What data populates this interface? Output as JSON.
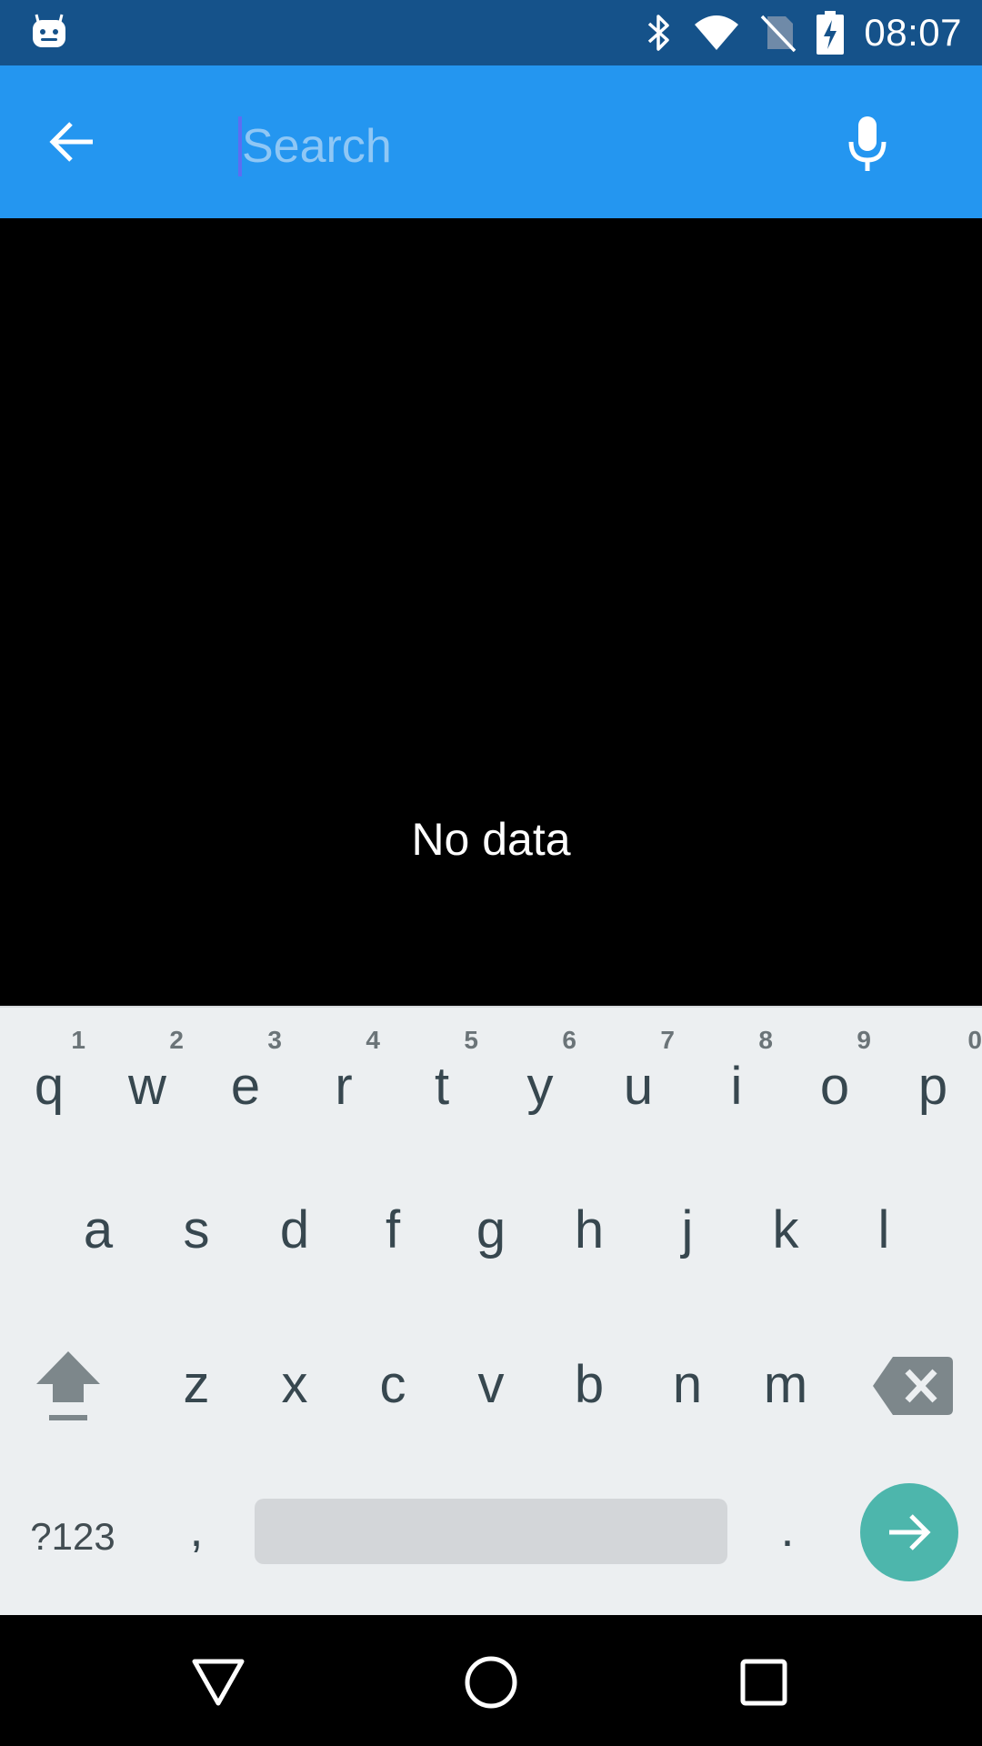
{
  "status_bar": {
    "time": "08:07",
    "icons": [
      "android-notification-icon",
      "bluetooth-icon",
      "wifi-icon",
      "no-sim-icon",
      "battery-charging-icon"
    ]
  },
  "app_bar": {
    "back_icon": "arrow-back-icon",
    "search_placeholder": "Search",
    "search_value": "",
    "mic_icon": "mic-icon"
  },
  "content": {
    "empty_message": "No data"
  },
  "keyboard": {
    "row1": [
      {
        "key": "q",
        "hint": "1"
      },
      {
        "key": "w",
        "hint": "2"
      },
      {
        "key": "e",
        "hint": "3"
      },
      {
        "key": "r",
        "hint": "4"
      },
      {
        "key": "t",
        "hint": "5"
      },
      {
        "key": "y",
        "hint": "6"
      },
      {
        "key": "u",
        "hint": "7"
      },
      {
        "key": "i",
        "hint": "8"
      },
      {
        "key": "o",
        "hint": "9"
      },
      {
        "key": "p",
        "hint": "0"
      }
    ],
    "row2": [
      "a",
      "s",
      "d",
      "f",
      "g",
      "h",
      "j",
      "k",
      "l"
    ],
    "row3": [
      "z",
      "x",
      "c",
      "v",
      "b",
      "n",
      "m"
    ],
    "symbols_label": "?123",
    "comma_label": ",",
    "period_label": ".",
    "enter_icon": "arrow-forward-icon",
    "shift_icon": "shift-icon",
    "delete_icon": "backspace-icon"
  },
  "nav_bar": {
    "icons": [
      "back-triangle-icon",
      "home-circle-icon",
      "recents-square-icon"
    ]
  },
  "colors": {
    "status_bar": "#15528a",
    "app_bar": "#2496f0",
    "keyboard_bg": "#eceff1",
    "enter_key": "#4db6ac"
  }
}
